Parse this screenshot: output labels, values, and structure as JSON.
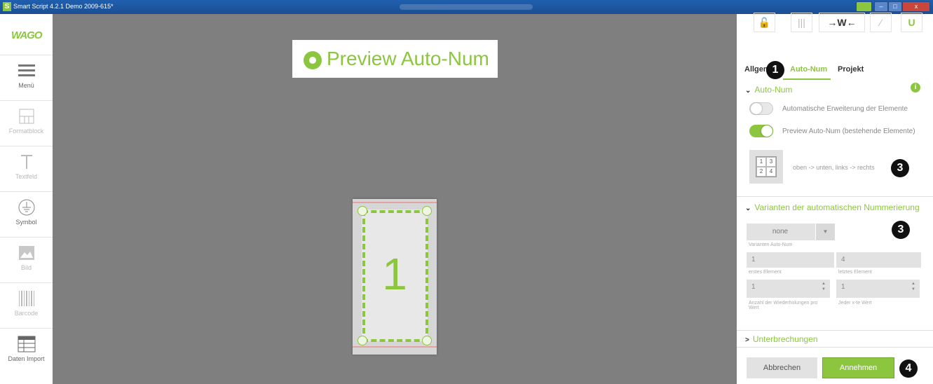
{
  "titlebar": {
    "app_icon": "S",
    "title": "Smart Script 4.2.1   Demo 2009-615*"
  },
  "window_controls": {
    "minimize": "–",
    "maximize": "□",
    "close": "x"
  },
  "sidebar": {
    "logo": "WAGO",
    "items": [
      {
        "label": "Menü",
        "icon": "menu-icon",
        "enabled": true
      },
      {
        "label": "Formatblock",
        "icon": "format-block-icon",
        "enabled": false
      },
      {
        "label": "Textfeld",
        "icon": "text-field-icon",
        "enabled": false
      },
      {
        "label": "Symbol",
        "icon": "ground-symbol-icon",
        "enabled": true
      },
      {
        "label": "Bild",
        "icon": "image-icon",
        "enabled": false
      },
      {
        "label": "Barcode",
        "icon": "barcode-icon",
        "enabled": false
      },
      {
        "label": "Daten Import",
        "icon": "data-import-icon",
        "enabled": true
      }
    ]
  },
  "canvas": {
    "preview_label": "Preview Auto-Num",
    "marker_number": "1"
  },
  "panel": {
    "toolbar": [
      {
        "name": "lock",
        "glyph": "🔓"
      },
      {
        "name": "columns",
        "glyph": "|||"
      },
      {
        "name": "width",
        "glyph": "→W←"
      },
      {
        "name": "wand",
        "glyph": "⁄"
      },
      {
        "name": "magnet",
        "glyph": "U"
      }
    ],
    "tabs": [
      {
        "label": "Allgemein",
        "active": false
      },
      {
        "label": "Auto-Num",
        "active": true
      },
      {
        "label": "Projekt",
        "active": false
      }
    ],
    "autonum": {
      "title": "Auto-Num",
      "toggle1_label": "Automatische Erweiterung der Elemente",
      "toggle1_on": false,
      "toggle2_label": "Preview Auto-Num (bestehende Elemente)",
      "toggle2_on": true,
      "order_cells": [
        "1",
        "3",
        "2",
        "4"
      ],
      "order_text": "oben -> unten, links -> rechts"
    },
    "variants": {
      "title": "Varianten der automatischen Nummerierung",
      "select_value": "none",
      "select_hint": "Varianten Auto-Num",
      "first_value": "1",
      "first_hint": "erstes Element",
      "last_value": "4",
      "last_hint": "letztes Element",
      "repeat_value": "1",
      "repeat_hint": "Anzahl der Wiederholungen pro Wert",
      "every_value": "1",
      "every_hint": "Jeder x-te Wert"
    },
    "breaks": {
      "title": "Unterbrechungen"
    },
    "buttons": {
      "cancel": "Abbrechen",
      "accept": "Annehmen"
    }
  },
  "badges": [
    "1",
    "3",
    "3",
    "4"
  ],
  "colors": {
    "accent": "#8cc63f",
    "canvas": "#7f7f7f",
    "titlebar": "#1f5fae"
  }
}
